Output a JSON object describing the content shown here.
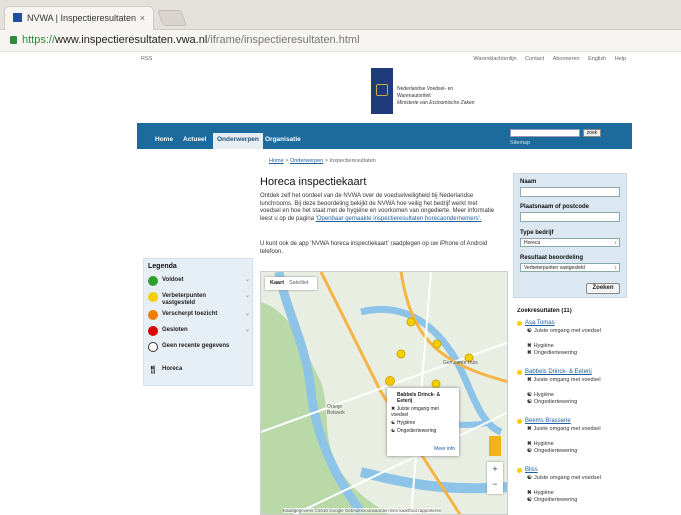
{
  "browser": {
    "tab_title": "NVWA | Inspectieresultaten",
    "tab_close": "×",
    "url_scheme": "https://",
    "url_host": "www.inspectieresultaten.vwa.nl",
    "url_path": "/iframe/inspectieresultaten.html"
  },
  "toplinks": {
    "rss": "RSS",
    "items": [
      "Warenklachtenlijn",
      "Contact",
      "Abonneren",
      "English",
      "Help"
    ]
  },
  "logo": {
    "line1": "Nederlandse Voedsel- en",
    "line2": "Warenautoriteit",
    "line3": "Ministerie van Economische Zaken"
  },
  "nav": {
    "items": [
      "Home",
      "Actueel",
      "Onderwerpen",
      "Organisatie"
    ],
    "active": "Onderwerpen",
    "search_button": "zoek",
    "sitemap": "Sitemap"
  },
  "breadcrumb": {
    "home": "Home",
    "sep1": " > ",
    "topics": "Onderwerpen",
    "sep2": " > ",
    "current": "Inspectieresultaten"
  },
  "content": {
    "title": "Horeca inspectiekaart",
    "intro_text": "Ontdek zelf het oordeel van de NVWA over de voedselveiligheid bij Nederlandse lunchrooms. Bij deze beoordeling bekijkt de NVWA hoe veilig het bedrijf werkt met voedsel en hoe het staat met de hygiëne en voorkomen van ongedierte. Meer informatie leest u op de pagina",
    "intro_link": "'Openbaar gemaakte inspectieresultaten horecaondernemers'.",
    "app_text": "U kunt ook de app 'NVWA horeca inspectiekaart' raadplegen op uw iPhone of Android telefoon."
  },
  "legend": {
    "title": "Legenda",
    "items": [
      {
        "label": "Voldoet",
        "color": "#2e9e2e"
      },
      {
        "label": "Verbeterpunten vastgesteld",
        "color": "#f4d000"
      },
      {
        "label": "Verscherpt toezicht",
        "color": "#f07d00"
      },
      {
        "label": "Gesloten",
        "color": "#e00000"
      },
      {
        "label": "Geen recente gegevens",
        "color": "#ffffff"
      }
    ],
    "horeca": "Horeca"
  },
  "map": {
    "type_map": "Kaart",
    "type_sat": "Satelliet",
    "labels": [
      "Gemeente Huis",
      "Oranje Bolwerk"
    ],
    "popup_title": "Babbels Drinck- & Eeterij",
    "popup_lines": [
      "Juiste omgang met voedsel",
      "Hygiëne",
      "Ongediertewering"
    ],
    "popup_more": "Meer info",
    "zoom_in": "+",
    "zoom_out": "−",
    "attribution": "Kaartgegevens ©2016 Google   Gebruiksvoorwaarden   Een kaartfout rapporteren"
  },
  "search": {
    "name_label": "Naam",
    "place_label": "Plaatsnaam of postcode",
    "type_label": "Type bedrijf",
    "type_value": "Horeca",
    "result_label": "Resultaat beoordeling",
    "result_value": "Verbeterpunten vastgesteld",
    "button": "Zoeken"
  },
  "results": {
    "title": "Zoekresultaten (11)",
    "items": [
      {
        "name": "Asa Tomas",
        "lines": [
          "Juiste omgang met voedsel",
          "Hygiëne",
          "Ongediertewering"
        ]
      },
      {
        "name": "Babbels Drinck- & Eeterij",
        "lines": [
          "Juiste omgang met voedsel",
          "Hygiëne",
          "Ongediertewering"
        ]
      },
      {
        "name": "Beems Brasserie",
        "lines": [
          "Juiste omgang met voedsel",
          "Hygiëne",
          "Ongediertewering"
        ]
      },
      {
        "name": "Bliss",
        "lines": [
          "Juiste omgang met voedsel",
          "Hygiëne",
          "Ongediertewering"
        ]
      }
    ]
  }
}
